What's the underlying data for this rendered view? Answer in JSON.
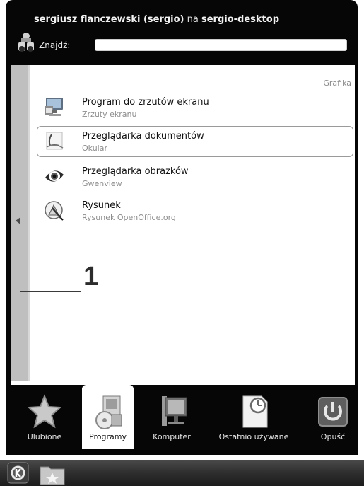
{
  "header": {
    "user_name": "sergiusz flanczewski (sergio)",
    "connector": "na",
    "host": "sergio-desktop",
    "search_label": "Znajdź:",
    "search_value": ""
  },
  "content": {
    "category": "Grafika",
    "apps": [
      {
        "title": "Program do zrzutów ekranu",
        "subtitle": "Zrzuty ekranu",
        "icon": "screenshot-icon",
        "selected": false
      },
      {
        "title": "Przeglądarka dokumentów",
        "subtitle": "Okular",
        "icon": "okular-icon",
        "selected": true
      },
      {
        "title": "Przeglądarka obrazków",
        "subtitle": "Gwenview",
        "icon": "gwenview-eye-icon",
        "selected": false
      },
      {
        "title": "Rysunek",
        "subtitle": "Rysunek OpenOffice.org",
        "icon": "draw-icon",
        "selected": false
      }
    ],
    "callout": "1"
  },
  "tabs": [
    {
      "label": "Ulubione",
      "icon": "star-icon",
      "active": false
    },
    {
      "label": "Programy",
      "icon": "applications-icon",
      "active": true
    },
    {
      "label": "Komputer",
      "icon": "computer-monitor-icon",
      "active": false
    },
    {
      "label": "Ostatnio używane",
      "icon": "recent-documents-icon",
      "active": false
    },
    {
      "label": "Opuść",
      "icon": "power-icon",
      "active": false
    }
  ],
  "taskbar": {
    "items": [
      "kde-menu-icon",
      "folder-star-icon"
    ]
  }
}
